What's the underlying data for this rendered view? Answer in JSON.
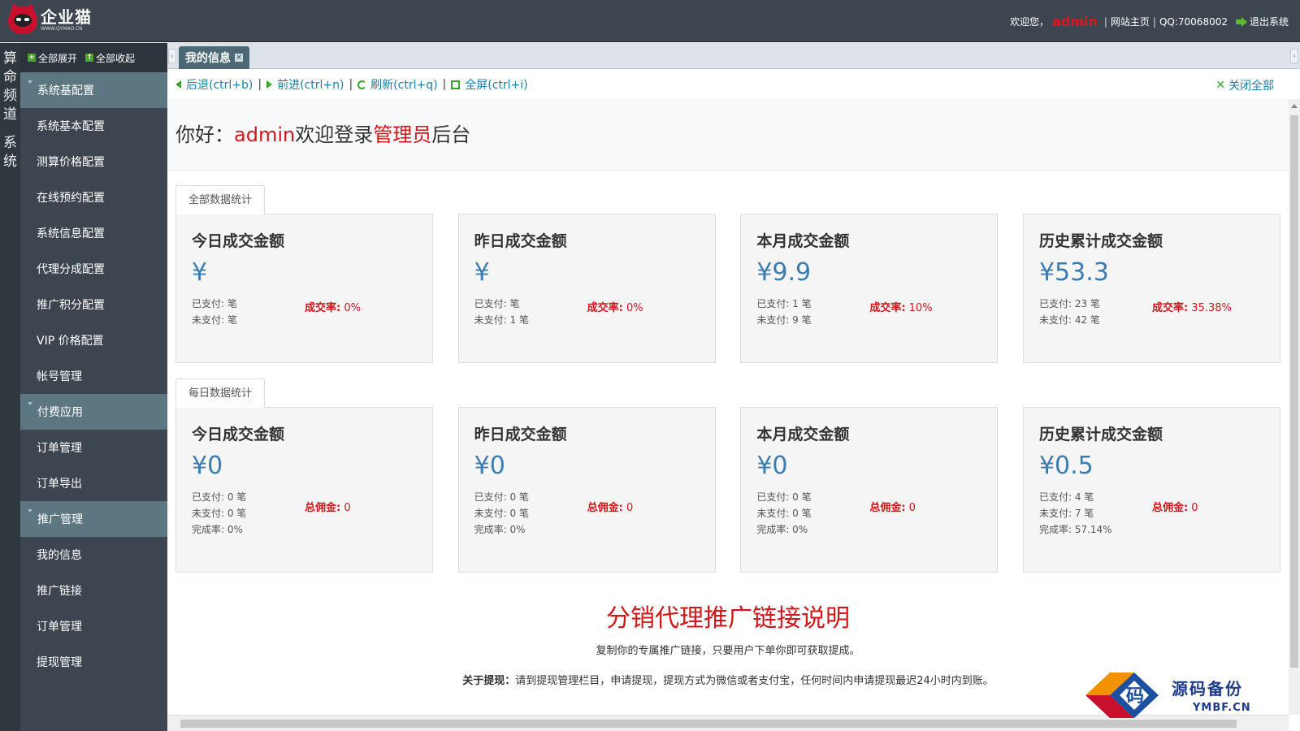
{
  "header": {
    "brand_name": "企业猫",
    "brand_sub": "WWW.QYMAO.CN",
    "welcome_prefix": "欢迎您，",
    "username": "admin",
    "site_home": "网站主页",
    "qq": "QQ:70068002",
    "logout": "退出系统"
  },
  "vertical_tabs": [
    "算命频道",
    "系统"
  ],
  "sidebar": {
    "expand_all": "全部展开",
    "collapse_all": "全部收起",
    "groups": [
      {
        "label": "系统基配置",
        "items": [
          "系统基本配置",
          "测算价格配置",
          "在线预约配置",
          "系统信息配置",
          "代理分成配置",
          "推广积分配置",
          "VIP 价格配置",
          "帐号管理"
        ]
      },
      {
        "label": "付费应用",
        "items": [
          "订单管理",
          "订单导出"
        ]
      },
      {
        "label": "推广管理",
        "items": [
          "我的信息",
          "推广链接",
          "订单管理",
          "提现管理"
        ]
      }
    ]
  },
  "tabs": {
    "active": "我的信息"
  },
  "toolbar": {
    "back": "后退(ctrl+b)",
    "forward": "前进(ctrl+n)",
    "refresh": "刷新(ctrl+q)",
    "fullscreen": "全屏(ctrl+i)",
    "close_all": "关闭全部"
  },
  "welcome": {
    "hello": "你好：",
    "user": "admin",
    "mid": "欢迎登录",
    "role": "管理员",
    "suffix": "后台"
  },
  "sections": {
    "total_label": "全部数据统计",
    "daily_label": "每日数据统计"
  },
  "total_cards": [
    {
      "title": "今日成交金额",
      "amount": "¥",
      "paid": "已支付: 笔",
      "unpaid": "未支付: 笔",
      "rate_label": "成交率:",
      "rate": " 0%"
    },
    {
      "title": "昨日成交金额",
      "amount": "¥",
      "paid": "已支付: 笔",
      "unpaid": "未支付: 1 笔",
      "rate_label": "成交率:",
      "rate": " 0%"
    },
    {
      "title": "本月成交金额",
      "amount": "¥9.9",
      "paid": "已支付: 1 笔",
      "unpaid": "未支付: 9 笔",
      "rate_label": "成交率:",
      "rate": " 10%"
    },
    {
      "title": "历史累计成交金额",
      "amount": "¥53.3",
      "paid": "已支付: 23 笔",
      "unpaid": "未支付: 42 笔",
      "rate_label": "成交率:",
      "rate": " 35.38%"
    }
  ],
  "daily_cards": [
    {
      "title": "今日成交金额",
      "amount": "¥0",
      "paid": "已支付: 0 笔",
      "unpaid": "未支付: 0 笔",
      "done": "完成率: 0%",
      "comm_label": "总佣金:",
      "comm": " 0"
    },
    {
      "title": "昨日成交金额",
      "amount": "¥0",
      "paid": "已支付: 0 笔",
      "unpaid": "未支付: 0 笔",
      "done": "完成率: 0%",
      "comm_label": "总佣金:",
      "comm": " 0"
    },
    {
      "title": "本月成交金额",
      "amount": "¥0",
      "paid": "已支付: 0 笔",
      "unpaid": "未支付: 0 笔",
      "done": "完成率: 0%",
      "comm_label": "总佣金:",
      "comm": " 0"
    },
    {
      "title": "历史累计成交金额",
      "amount": "¥0.5",
      "paid": "已支付: 4 笔",
      "unpaid": "未支付: 7 笔",
      "done": "完成率: 57.14%",
      "comm_label": "总佣金:",
      "comm": " 0"
    }
  ],
  "promo": {
    "title": "分销代理推广链接说明",
    "line1": "复制你的专属推广链接，只要用户下单你即可获取提成。",
    "line2_label": "关于提现：",
    "line2": "请到提现管理栏目，申请提现，提现方式为微信或者支付宝，任何时间内申请提现最迟24小时内到账。"
  },
  "watermark": {
    "glyph": "码",
    "text": "源码备份",
    "url": "YMBF.CN"
  }
}
